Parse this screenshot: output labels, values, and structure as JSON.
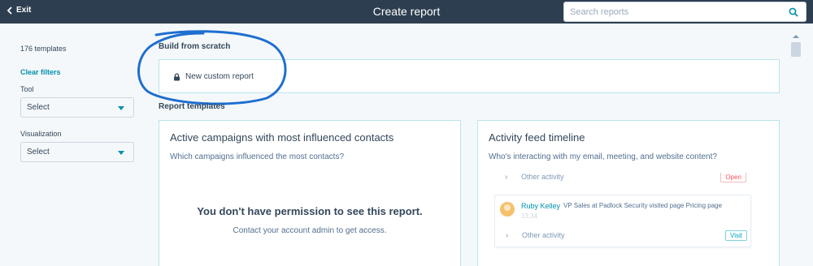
{
  "header": {
    "exit_label": "Exit",
    "title": "Create report",
    "search_placeholder": "Search reports"
  },
  "sidebar": {
    "template_count": "176 templates",
    "clear_filters": "Clear filters",
    "filters": [
      {
        "label": "Tool",
        "value": "Select"
      },
      {
        "label": "Visualization",
        "value": "Select"
      }
    ]
  },
  "main": {
    "build_title": "Build from scratch",
    "custom_report_label": "New custom report",
    "templates_title": "Report templates",
    "cards": [
      {
        "title": "Active campaigns with most influenced contacts",
        "question": "Which campaigns influenced the most contacts?",
        "permission_title": "You don't have permission to see this report.",
        "permission_text": "Contact your account admin to get access."
      },
      {
        "title": "Activity feed timeline",
        "question": "Who's interacting with my email, meeting, and website content?",
        "feed": {
          "item1_text": "Other activity",
          "item1_tag": "Open",
          "person_name": "Ruby Kelley",
          "person_desc": "VP Sales at Padlock Security visited page Pricing page",
          "time": "13:34",
          "item2_text": "Other activity",
          "item2_tag": "Visit"
        }
      }
    ]
  },
  "colors": {
    "header_bg": "#2d3e50",
    "accent": "#0091ae",
    "card_border": "#b9e4ec",
    "annotation": "#1e6fd0"
  },
  "icons": [
    "back-chevron-icon",
    "search-icon",
    "lock-icon",
    "chevron-right-icon",
    "caret-down-icon"
  ]
}
